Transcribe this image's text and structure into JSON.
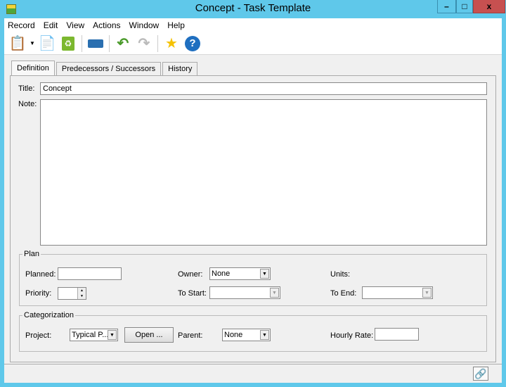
{
  "window": {
    "title": "Concept - Task Template",
    "minimize": "–",
    "maximize": "□",
    "close": "x"
  },
  "menu": [
    "Record",
    "Edit",
    "View",
    "Actions",
    "Window",
    "Help"
  ],
  "toolbar": [
    {
      "icon": "new-record-icon"
    },
    {
      "icon": "dropdown-arrow-icon"
    },
    {
      "icon": "copy-add-icon"
    },
    {
      "icon": "recycle-bin-icon"
    },
    {
      "icon": "print-icon"
    },
    {
      "icon": "undo-icon"
    },
    {
      "icon": "redo-icon"
    },
    {
      "icon": "star-icon"
    },
    {
      "icon": "help-icon"
    }
  ],
  "tabs": [
    "Definition",
    "Predecessors / Successors",
    "History"
  ],
  "form": {
    "title_label": "Title:",
    "title_value": "Concept",
    "note_label": "Note:",
    "note_value": ""
  },
  "plan": {
    "legend": "Plan",
    "planned_label": "Planned:",
    "planned_value": "",
    "priority_label": "Priority:",
    "priority_value": "",
    "owner_label": "Owner:",
    "owner_value": "None",
    "to_start_label": "To Start:",
    "to_start_value": "",
    "units_label": "Units:",
    "to_end_label": "To End:",
    "to_end_value": ""
  },
  "categorization": {
    "legend": "Categorization",
    "project_label": "Project:",
    "project_value": "Typical P...",
    "open_button": "Open ...",
    "parent_label": "Parent:",
    "parent_value": "None",
    "hourly_rate_label": "Hourly Rate:",
    "hourly_rate_value": ""
  },
  "colors": {
    "frame": "#5fc8ea",
    "close": "#c75050"
  }
}
